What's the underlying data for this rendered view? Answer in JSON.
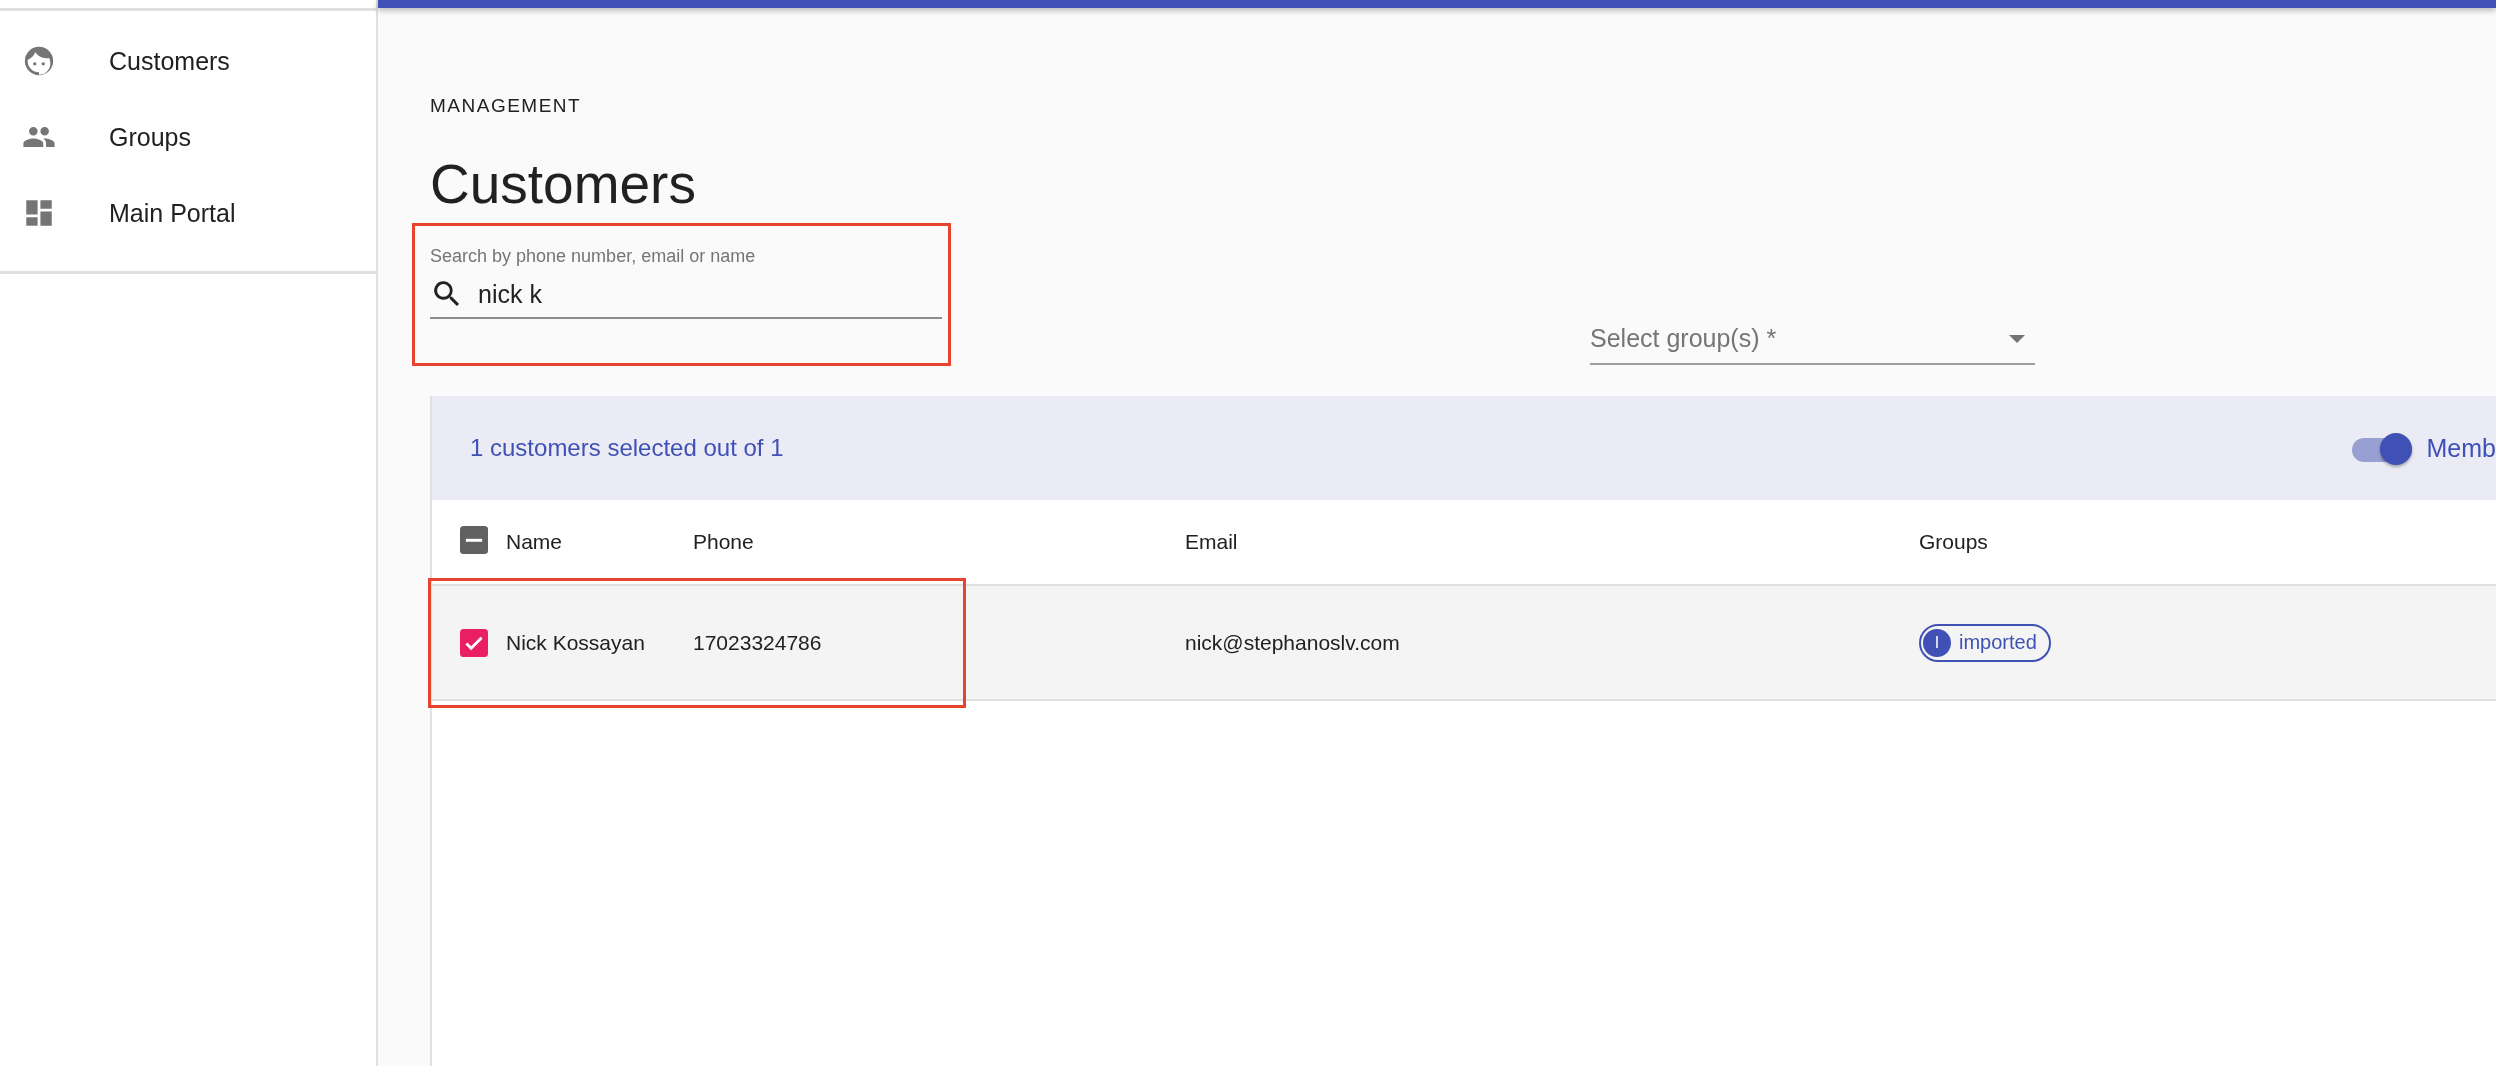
{
  "sidebar": {
    "items": [
      {
        "kind": "face",
        "label": "Customers",
        "selected": false
      },
      {
        "kind": "people",
        "label": "Groups",
        "selected": false
      },
      {
        "kind": "dashboard",
        "label": "Main Portal",
        "selected": false
      }
    ]
  },
  "page": {
    "overline": "MANAGEMENT",
    "title": "Customers"
  },
  "search": {
    "placeholder": "Search by phone number, email or name",
    "value": "nick k",
    "highlighted": true
  },
  "group_select": {
    "placeholder": "Select group(s) *"
  },
  "table": {
    "selection_text": "1 customers selected out of 1",
    "toggle": {
      "label": "Memb",
      "on": true
    },
    "header_checkbox": {
      "indeterminate": true
    },
    "columns": [
      "Name",
      "Phone",
      "Email",
      "Groups"
    ],
    "rows": [
      {
        "selected": true,
        "highlighted": true,
        "cells": [
          "Nick Kossayan",
          "17023324786",
          "nick@stephanoslv.com"
        ],
        "groups": [
          {
            "initial": "I",
            "label": "imported"
          }
        ]
      }
    ]
  }
}
